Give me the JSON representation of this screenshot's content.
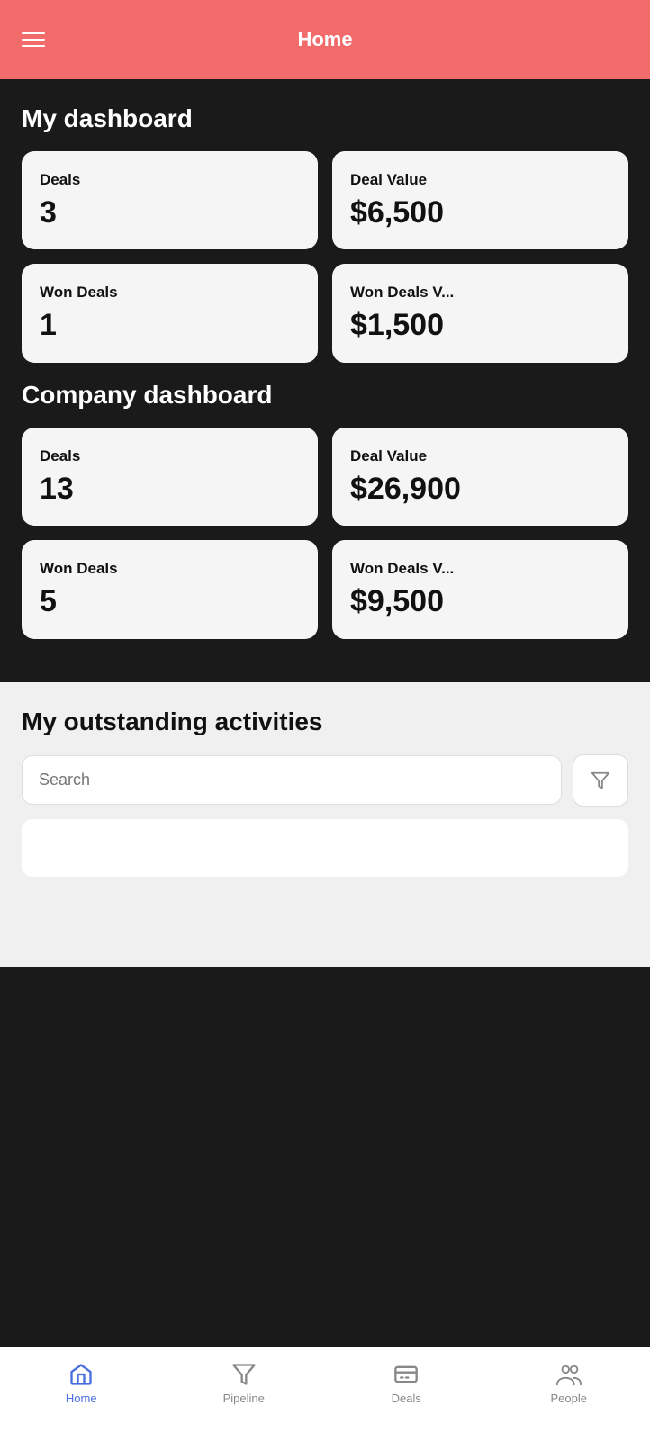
{
  "header": {
    "title": "Home",
    "menu_icon": "menu-icon"
  },
  "my_dashboard": {
    "section_title": "My dashboard",
    "cards": [
      {
        "label": "Deals",
        "value": "3"
      },
      {
        "label": "Deal Value",
        "value": "$6,500"
      },
      {
        "label": "Won Deals",
        "value": "1"
      },
      {
        "label": "Won Deals V...",
        "value": "$1,500"
      }
    ]
  },
  "company_dashboard": {
    "section_title": "Company dashboard",
    "cards": [
      {
        "label": "Deals",
        "value": "13"
      },
      {
        "label": "Deal Value",
        "value": "$26,900"
      },
      {
        "label": "Won Deals",
        "value": "5"
      },
      {
        "label": "Won Deals V...",
        "value": "$9,500"
      }
    ]
  },
  "activities": {
    "section_title": "My outstanding activities",
    "search_placeholder": "Search"
  },
  "bottom_nav": {
    "items": [
      {
        "label": "Home",
        "icon": "home-icon",
        "active": true
      },
      {
        "label": "Pipeline",
        "icon": "pipeline-icon",
        "active": false
      },
      {
        "label": "Deals",
        "icon": "deals-icon",
        "active": false
      },
      {
        "label": "People",
        "icon": "people-icon",
        "active": false
      }
    ]
  }
}
